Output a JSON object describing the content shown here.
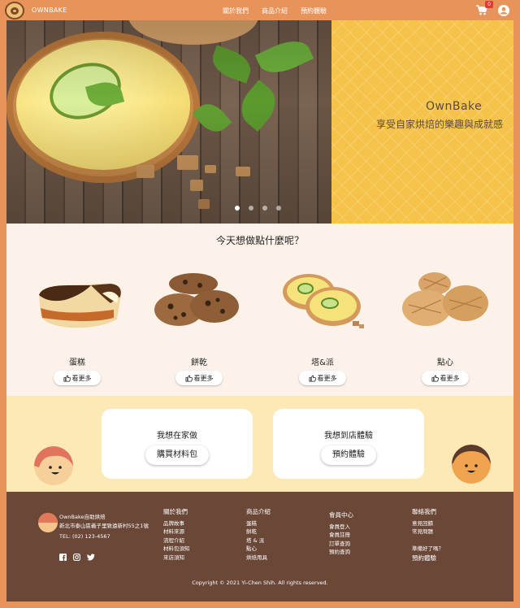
{
  "nav": {
    "brand": "OWNBAKE",
    "links": [
      "關於我們",
      "商品介紹",
      "預約體驗"
    ],
    "cart_count": "0",
    "icons": [
      "logo",
      "cart-icon",
      "user-icon"
    ]
  },
  "hero": {
    "title": "OwnBake",
    "subtitle": "享受自家烘焙的樂趣與成就感",
    "slides_total": 4,
    "active_slide": 1,
    "pattern_color": "#f6c34a"
  },
  "categories": {
    "title": "今天想做點什麼呢？",
    "items": [
      {
        "name": "蛋糕",
        "button": "看更多"
      },
      {
        "name": "餅乾",
        "button": "看更多"
      },
      {
        "name": "塔&派",
        "button": "看更多"
      },
      {
        "name": "點心",
        "button": "看更多"
      }
    ],
    "button_icon": "hand-point-icon"
  },
  "cta": {
    "left": {
      "text": "我想在家做",
      "button": "購買材料包"
    },
    "right": {
      "text": "我想到店體驗",
      "button": "預約體驗"
    }
  },
  "footer": {
    "company": "OwnBake自助烘焙",
    "address": "新北市泰山區義子里致遠新村55之1號",
    "tel": "TEL: (02) 123-4567",
    "columns": [
      {
        "heading": "關於我們",
        "items": [
          "品牌故事",
          "材料來源",
          "流程介紹",
          "材料包須知",
          "來店須知"
        ]
      },
      {
        "heading": "商品介紹",
        "items": [
          "蛋糕",
          "餅乾",
          "塔 & 派",
          "點心",
          "烘焙用具"
        ]
      },
      {
        "heading": "會員中心",
        "items": [
          "會員登入",
          "會員註冊",
          "訂單查詢",
          "預約查詢"
        ]
      },
      {
        "heading": "聯絡我們",
        "items": [
          "意見回饋",
          "常見問題"
        ],
        "extra_heading": "準備好了嗎？",
        "extra_items": [
          "預約體驗"
        ]
      }
    ],
    "copyright": "Copyright © 2021 Yi-Chen Shih. All rights reserved."
  },
  "colors": {
    "header": "#e8935a",
    "section_bg": "#fdf2e9",
    "cta_bg": "#fde9b6",
    "footer_bg": "#6a4737"
  }
}
